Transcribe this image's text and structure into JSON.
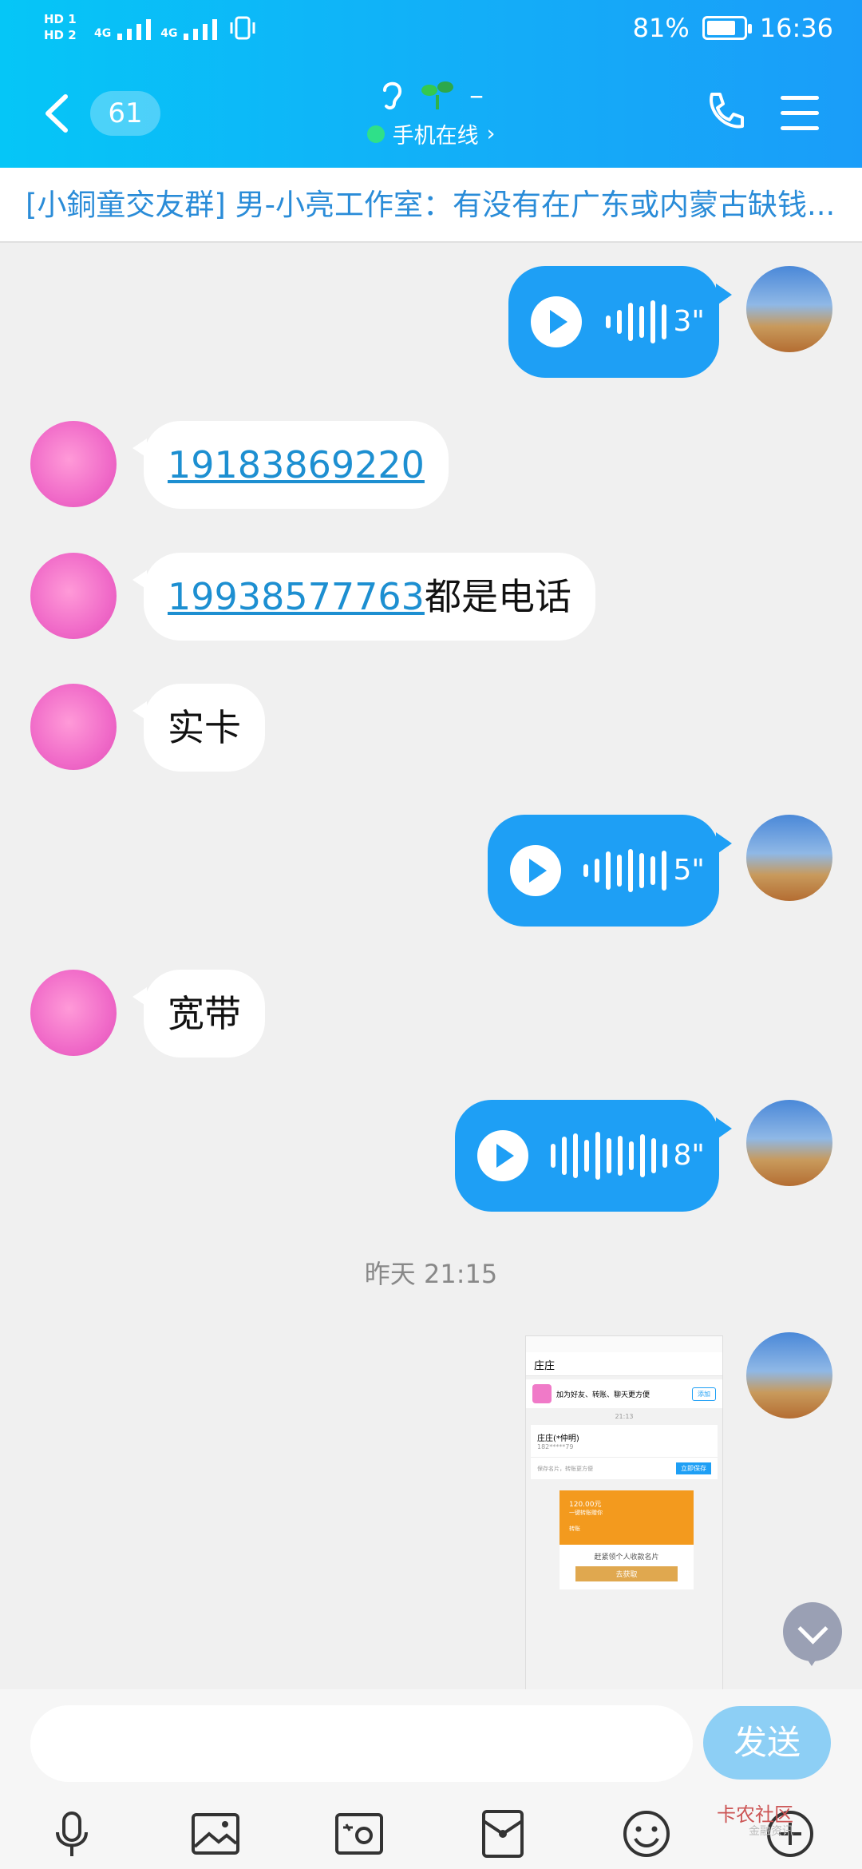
{
  "status": {
    "signal_labels": [
      "HD 1",
      "HD 2"
    ],
    "network": [
      "4G",
      "4G"
    ],
    "battery": "81%",
    "time": "16:36"
  },
  "header": {
    "unread_count": "61",
    "contact_name": "–",
    "online_status": "手机在线",
    "online_chevron": "›"
  },
  "notice": {
    "text": "[小銅童交友群] 男-小亮工作室：有没有在广东或内蒙古缺钱..."
  },
  "messages": {
    "voice1": {
      "duration": "3\""
    },
    "m1": {
      "link": "19183869220"
    },
    "m2": {
      "link": "19938577763",
      "text": "都是电话"
    },
    "m3": {
      "text": "实卡"
    },
    "voice2": {
      "duration": "5\""
    },
    "m4": {
      "text": "宽带"
    },
    "voice3": {
      "duration": "8\""
    },
    "timestamp": "昨天 21:15"
  },
  "screenshot_preview": {
    "header": "庄庄",
    "add_friend": "加为好友、转账、聊天更方便",
    "add_button": "添加",
    "time": "21:13",
    "contact_name": "庄庄(*仲明)",
    "contact_phone": "182*****79",
    "save_hint": "保存名片，转账更方便",
    "save_button": "立即保存",
    "redpacket_amount": "120.00元",
    "redpacket_sub": "一键转账赠你",
    "redpacket_label": "转账",
    "redpacket_cta": "赶紧领个人收款名片",
    "redpacket_button": "去获取"
  },
  "input": {
    "placeholder": "",
    "send_label": "发送"
  },
  "watermark": {
    "title": "卡农社区",
    "sub": "金融资讯"
  },
  "colors": {
    "header_start": "#05c6f7",
    "header_end": "#1a9df9",
    "bubble_out": "#1e9ff5",
    "link": "#1d8fd1",
    "send_button": "#8dcff5"
  },
  "icons": [
    "back-icon",
    "ear-icon",
    "sprout-icon",
    "phone-icon",
    "menu-icon",
    "play-icon",
    "waveform-icon",
    "chevron-down-icon",
    "microphone-icon",
    "gallery-icon",
    "camera-icon",
    "red-packet-icon",
    "emoji-icon",
    "plus-icon"
  ]
}
